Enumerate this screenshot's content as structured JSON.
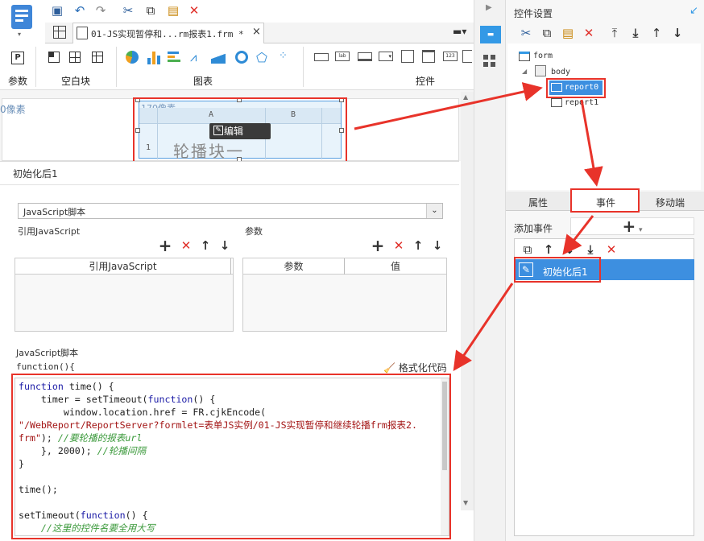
{
  "toolbar": {
    "groups": {
      "param": "参数",
      "blank_block": "空白块",
      "chart": "图表",
      "widget": "控件"
    }
  },
  "tab": {
    "title": "01-JS实现暂停和...rm报表1.frm *",
    "close": "×"
  },
  "canvas": {
    "left_px_label": "0像素",
    "widget_px_label": "170像素",
    "col_a": "A",
    "col_b": "B",
    "row_1": "1",
    "carousel_text": "轮播块一",
    "edit_button": "编辑"
  },
  "event_editor": {
    "event_title": "初始化后1",
    "script_type": "JavaScript脚本",
    "ref_js_label": "引用JavaScript",
    "param_label": "参数",
    "ref_js_col": "引用JavaScript",
    "param_col": "参数",
    "value_col": "值",
    "script_section_label": "JavaScript脚本",
    "function_head": "function(){",
    "format_code": "格式化代码",
    "code": {
      "l1a": "function",
      "l1b": " time() {",
      "l2a": "    timer = setTimeout(",
      "l2b": "function",
      "l2c": "() {",
      "l3": "        window.location.href = FR.cjkEncode(",
      "l4": "\"/WebReport/ReportServer?formlet=表单JS实例/01-JS实现暂停和继续轮播frm报表2.",
      "l5a": "frm\"",
      "l5b": "); ",
      "l5c": "//要轮播的报表url",
      "l6a": "    }, 2000); ",
      "l6b": "//轮播间隔",
      "l7": "}",
      "l8": "",
      "l9": "time();",
      "l10": "",
      "l11a": "setTimeout(",
      "l11b": "function",
      "l11c": "() {",
      "l12": "    //这里的控件名要全用大写"
    }
  },
  "right_panel": {
    "title": "控件设置",
    "tree": {
      "form": "form",
      "body": "body",
      "report0": "report0",
      "report1": "report1"
    },
    "tabs": {
      "properties": "属性",
      "events": "事件",
      "mobile": "移动端"
    },
    "add_event_label": "添加事件",
    "add_symbol": "+",
    "event_item": "初始化后1"
  },
  "colors": {
    "accent": "#3399e6",
    "highlight": "#e8332a",
    "selected_row": "#3d8fe0"
  }
}
